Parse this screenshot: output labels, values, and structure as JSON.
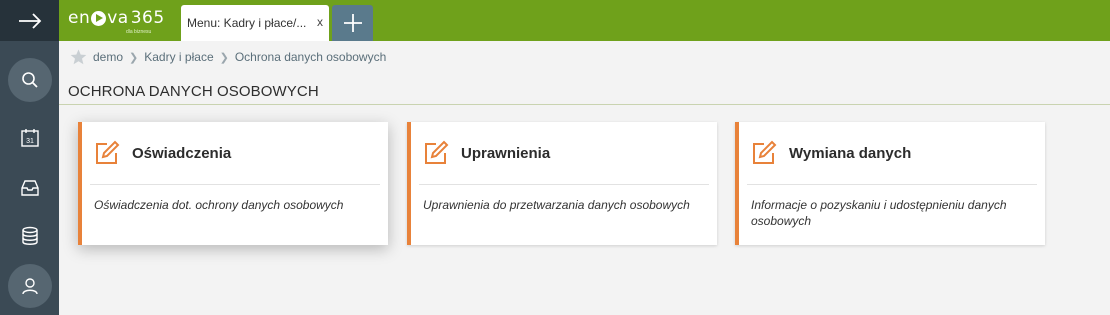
{
  "app": {
    "logo_text_a": "en",
    "logo_text_b": "va",
    "logo_number": "365",
    "logo_sub": "dla biznesu",
    "accent_color": "#6fa11b",
    "card_accent_color": "#e8823a"
  },
  "sidebar": {
    "items": [
      {
        "icon": "arrow-right-icon"
      },
      {
        "icon": "search-icon"
      },
      {
        "icon": "calendar-icon",
        "day": "31"
      },
      {
        "icon": "inbox-icon"
      },
      {
        "icon": "database-icon"
      },
      {
        "icon": "user-icon"
      }
    ]
  },
  "tabs": [
    {
      "label": "Menu: Kadry i płace/...",
      "close": "x"
    }
  ],
  "tab_add": {
    "icon": "plus-icon"
  },
  "breadcrumb": {
    "items": [
      "demo",
      "Kadry i płace",
      "Ochrona danych osobowych"
    ]
  },
  "page": {
    "title": "OCHRONA DANYCH OSOBOWYCH"
  },
  "cards": [
    {
      "title": "Oświadczenia",
      "description": "Oświadczenia dot. ochrony danych osobowych"
    },
    {
      "title": "Uprawnienia",
      "description": "Uprawnienia do przetwarzania danych osobowych"
    },
    {
      "title": "Wymiana danych",
      "description": "Informacje o pozyskaniu i udostępnieniu danych osobowych"
    }
  ]
}
